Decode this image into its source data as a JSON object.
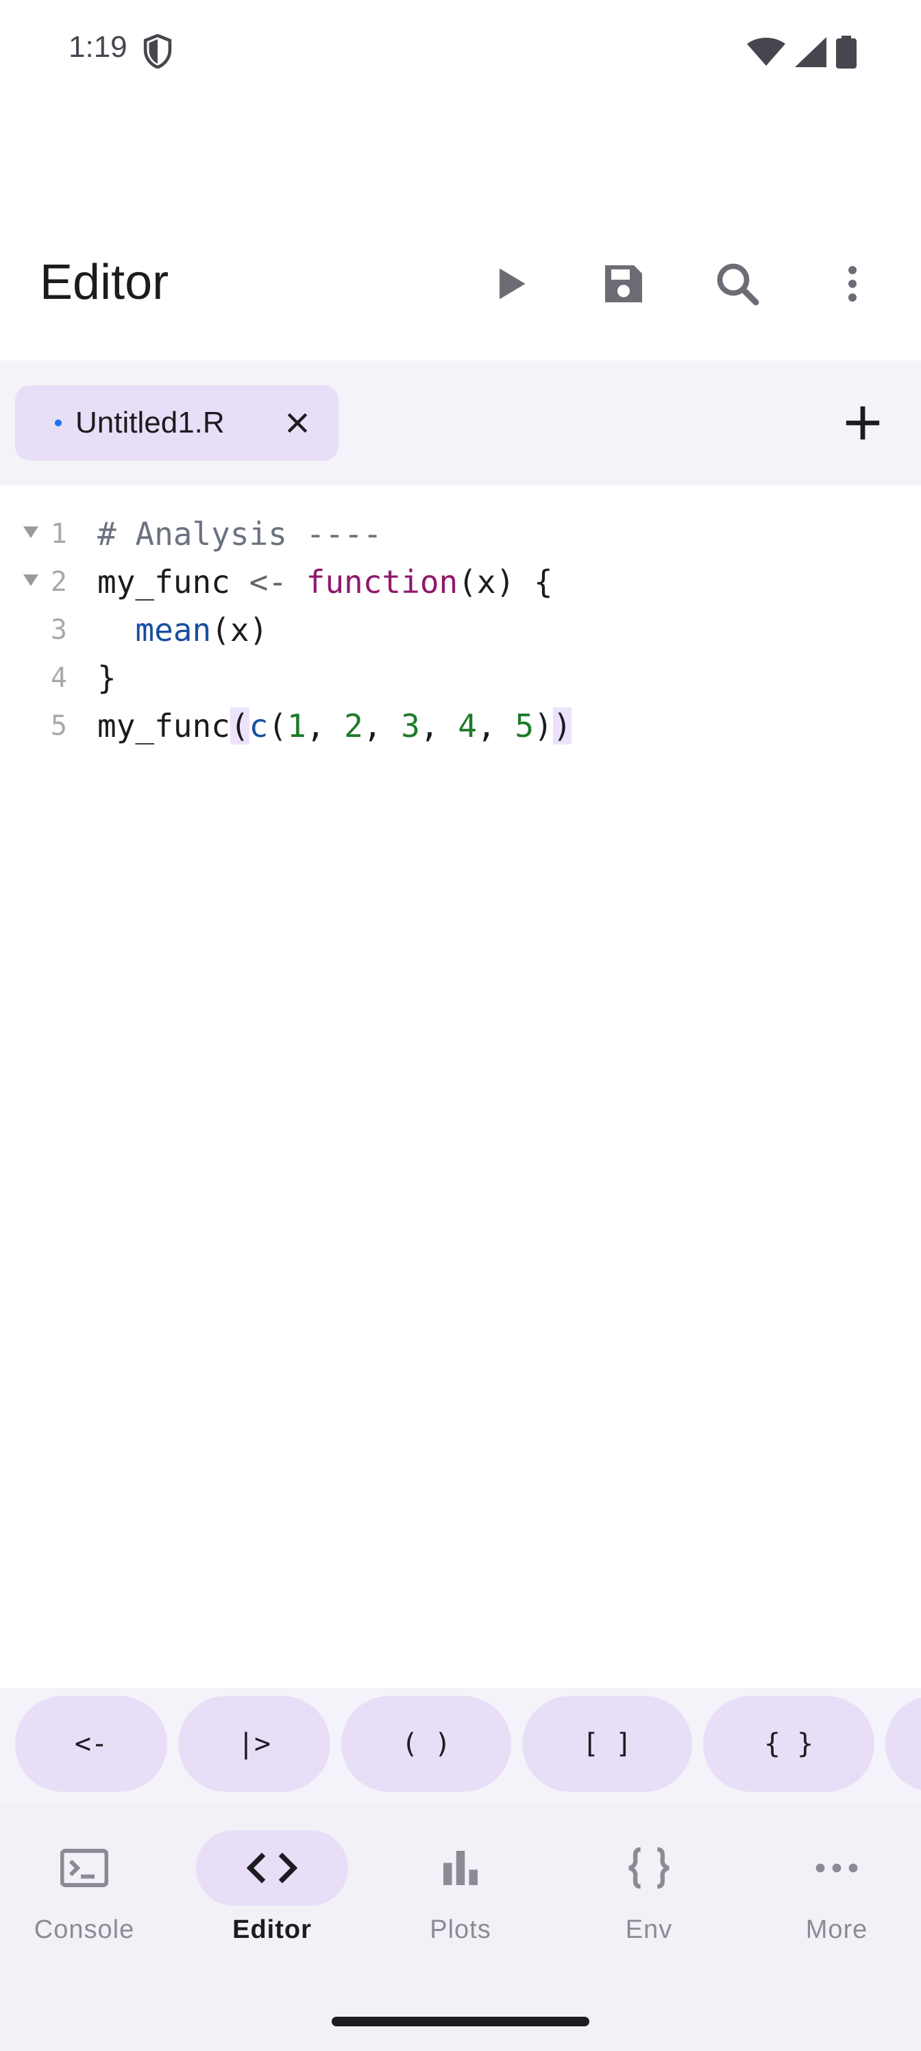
{
  "status_bar": {
    "time": "1:19"
  },
  "toolbar": {
    "title": "Editor"
  },
  "tabs": [
    {
      "label": "Untitled1.R",
      "modified": true
    }
  ],
  "editor": {
    "line_numbers": [
      "1",
      "2",
      "3",
      "4",
      "5"
    ],
    "lines": [
      "# Analysis ----",
      "my_func <- function(x) {",
      "  mean(x)",
      "}",
      "my_func(c(1, 2, 3, 4, 5))"
    ]
  },
  "keybar": {
    "keys": [
      "<-",
      "|>",
      "( )",
      "[ ]",
      "{ }"
    ]
  },
  "nav": {
    "items": [
      {
        "label": "Console",
        "icon": "console-icon"
      },
      {
        "label": "Editor",
        "icon": "code-icon",
        "active": true
      },
      {
        "label": "Plots",
        "icon": "bar-chart-icon"
      },
      {
        "label": "Env",
        "icon": "braces-icon"
      },
      {
        "label": "More",
        "icon": "more-horiz-icon"
      }
    ]
  },
  "colors": {
    "accent": "#e8def8",
    "surface": "#f4f3f9",
    "keyword": "#8e1a6b",
    "function": "#1a4fa0",
    "number": "#1e7a2a",
    "comment": "#6b7280"
  }
}
